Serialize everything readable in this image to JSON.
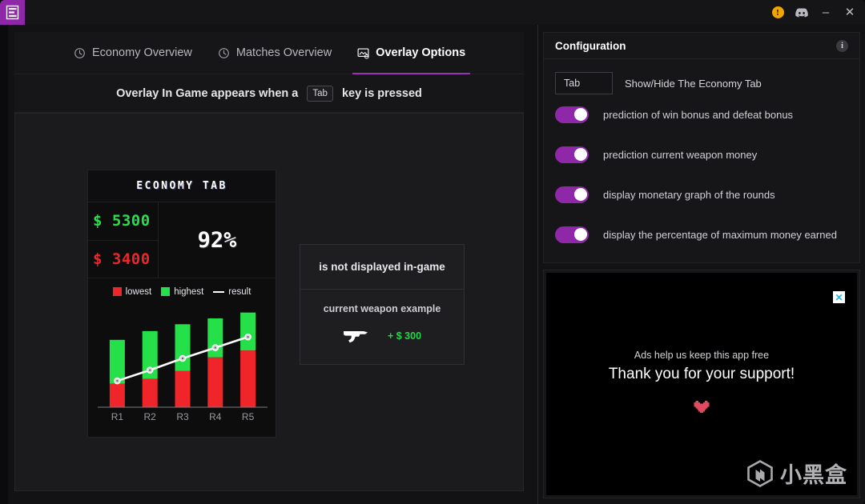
{
  "titlebar": {
    "logo_icon": "app-logo-icon",
    "warning_icon": "warning-icon",
    "warning_glyph": "!",
    "discord_icon": "discord-icon",
    "minimize_label": "–",
    "close_label": "✕"
  },
  "tabs": [
    {
      "label": "Economy Overview",
      "icon": "clock-icon",
      "active": false
    },
    {
      "label": "Matches Overview",
      "icon": "clock-icon",
      "active": false
    },
    {
      "label": "Overlay Options",
      "icon": "overlay-screen-icon",
      "active": true
    }
  ],
  "hint": {
    "prefix": "Overlay In Game appears when a",
    "key": "Tab",
    "suffix": "key is pressed"
  },
  "economy_widget": {
    "title": "Economy Tab",
    "highest_money": "$ 5300",
    "lowest_money": "$ 3400",
    "percent": "92%",
    "legend": [
      {
        "label": "lowest",
        "color": "#f0252a",
        "marker": "square"
      },
      {
        "label": "highest",
        "color": "#26e04a",
        "marker": "square"
      },
      {
        "label": "result",
        "color": "#ffffff",
        "marker": "line"
      }
    ]
  },
  "chart_data": {
    "type": "bar",
    "subtype": "stacked-bar-with-line",
    "title": "",
    "xlabel": "",
    "ylabel": "",
    "categories": [
      "R1",
      "R2",
      "R3",
      "R4",
      "R5"
    ],
    "ylim": [
      0,
      100
    ],
    "grid": false,
    "legend_position": "top",
    "series": [
      {
        "name": "lowest",
        "color": "#f0252a",
        "values": [
          24,
          29,
          37,
          51,
          58
        ]
      },
      {
        "name": "highest",
        "color": "#26e04a",
        "values": [
          69,
          78,
          85,
          91,
          97
        ]
      },
      {
        "name": "result",
        "color": "#ffffff",
        "type": "line",
        "values": [
          27,
          38,
          50,
          61,
          72
        ]
      }
    ]
  },
  "midbox": {
    "not_displayed": "is not displayed in-game",
    "weapon_label": "current weapon example",
    "weapon_icon": "pistol-icon",
    "weapon_price": "+ $ 300"
  },
  "configuration": {
    "title": "Configuration",
    "info_icon": "info-icon",
    "info_glyph": "i",
    "keybind": {
      "value": "Tab",
      "placeholder": "Tab",
      "label": "Show/Hide The Economy Tab"
    },
    "toggles": [
      {
        "label": "prediction of win bonus and defeat bonus",
        "on": true
      },
      {
        "label": "prediction current weapon money",
        "on": true
      },
      {
        "label": "display monetary graph of the rounds",
        "on": true
      },
      {
        "label": "display the percentage of maximum money earned",
        "on": true
      }
    ],
    "accent_color": "#8e27a8"
  },
  "ad": {
    "close_glyph": "✕",
    "subtitle": "Ads help us keep this app free",
    "title": "Thank you for your support!",
    "heart_icon": "pixel-heart-icon",
    "heart_color": "#e04a5c",
    "watermark_text": "小黑盒",
    "watermark_icon": "hexagon-h-logo-icon"
  }
}
